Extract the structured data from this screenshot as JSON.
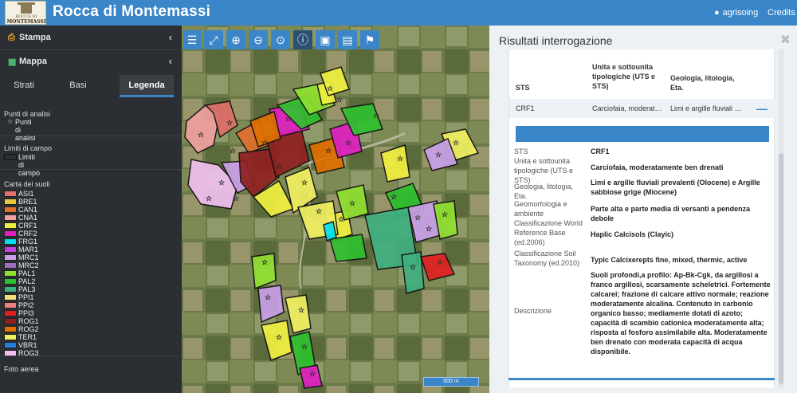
{
  "header": {
    "title": "Rocca di Montemassi",
    "logo_line1": "ROCCA DI",
    "logo_line2": "MONTEMASSI",
    "user": "agrisoing",
    "credits": "Credits"
  },
  "sidebar": {
    "sections": [
      {
        "label": "Stampa",
        "icon": "print-icon"
      },
      {
        "label": "Mappa",
        "icon": "map-icon"
      }
    ],
    "tabs": [
      {
        "label": "Strati"
      },
      {
        "label": "Basi"
      },
      {
        "label": "Legenda"
      }
    ],
    "legend": {
      "punti_group": "Punti di analisi",
      "punti_item": "Punti di analisi",
      "limiti_group": "Limiti di campo",
      "limiti_item": "Limiti di campo",
      "suoli_group": "Carta dei suoli",
      "items": [
        {
          "name": "ASI1",
          "color": "#e0706a"
        },
        {
          "name": "BRE1",
          "color": "#e8c840"
        },
        {
          "name": "CAN1",
          "color": "#e07030"
        },
        {
          "name": "CNA1",
          "color": "#f0a0a0"
        },
        {
          "name": "CRF1",
          "color": "#f0f040"
        },
        {
          "name": "CRF2",
          "color": "#e020c0"
        },
        {
          "name": "FRG1",
          "color": "#00e0f0"
        },
        {
          "name": "MAR1",
          "color": "#c040e0"
        },
        {
          "name": "MRC1",
          "color": "#c8a0e8"
        },
        {
          "name": "MRC2",
          "color": "#a070c0"
        },
        {
          "name": "PAL1",
          "color": "#90e030"
        },
        {
          "name": "PAL2",
          "color": "#30c030"
        },
        {
          "name": "PAL3",
          "color": "#40b080"
        },
        {
          "name": "PPI1",
          "color": "#f0e080"
        },
        {
          "name": "PPI2",
          "color": "#f08080"
        },
        {
          "name": "PPI3",
          "color": "#e02020"
        },
        {
          "name": "ROG1",
          "color": "#902020"
        },
        {
          "name": "ROG2",
          "color": "#e07000"
        },
        {
          "name": "TER1",
          "color": "#f0f060"
        },
        {
          "name": "VBR1",
          "color": "#2080e0"
        },
        {
          "name": "ROG3",
          "color": "#f0c0f0"
        }
      ],
      "foto_aerea": "Foto aerea"
    }
  },
  "map": {
    "scale_label": "500 m",
    "tools": [
      "expand-icon",
      "zoom-in-icon",
      "zoom-out-icon",
      "zoom-extent-icon",
      "info-icon",
      "select-box-icon",
      "document-info-icon",
      "pin-query-icon"
    ]
  },
  "results": {
    "title": "Risultati interrogazione",
    "columns": [
      "STS",
      "Unita e sottounita tipologiche (UTS e STS)",
      "Geologia, litologia, Eta."
    ],
    "row": {
      "sts": "CRF1",
      "unita": "Carciofaia, moderat…",
      "geologia": "Limi e argille fluviali …"
    },
    "details": [
      {
        "label": "STS",
        "value": "CRF1"
      },
      {
        "label": "Unita e sottounita tipologiche (UTS e STS)",
        "value": "Carciofaia, moderatamente ben drenati"
      },
      {
        "label": "Geologia, litologia, Eta.",
        "value": "Limi e argille fluviali prevalenti (Olocene) e Argille sabbiose grige (Miocene)"
      },
      {
        "label": "Geomorfologia e ambiente",
        "value": "Parte alta e parte media di versanti a pendenza debole"
      },
      {
        "label": "Classificazione World Reference Base (ed.2006)",
        "value": "Haplic Calcisols (Clayic)"
      },
      {
        "label": "Classificazione Soil Taxonomy (ed.2010)",
        "value": "Typic Calcixerepts fine, mixed, thermic, active"
      },
      {
        "label": "Descrizione",
        "value": "Suoli profondi,a profilo: Ap-Bk-Cgk, da argillosi a franco argillosi, scarsamente scheletrici. Fortemente calcarei; frazione di calcare attivo normale; reazione moderatamente alcalina. Contenuto in carbonio organico basso; mediamente dotati di azoto; capacità di scambio cationica moderatamente alta; risposta al fosforo assimilabile alta. Moderatamente ben drenato con moderata capacità di acqua disponibile."
      }
    ]
  }
}
